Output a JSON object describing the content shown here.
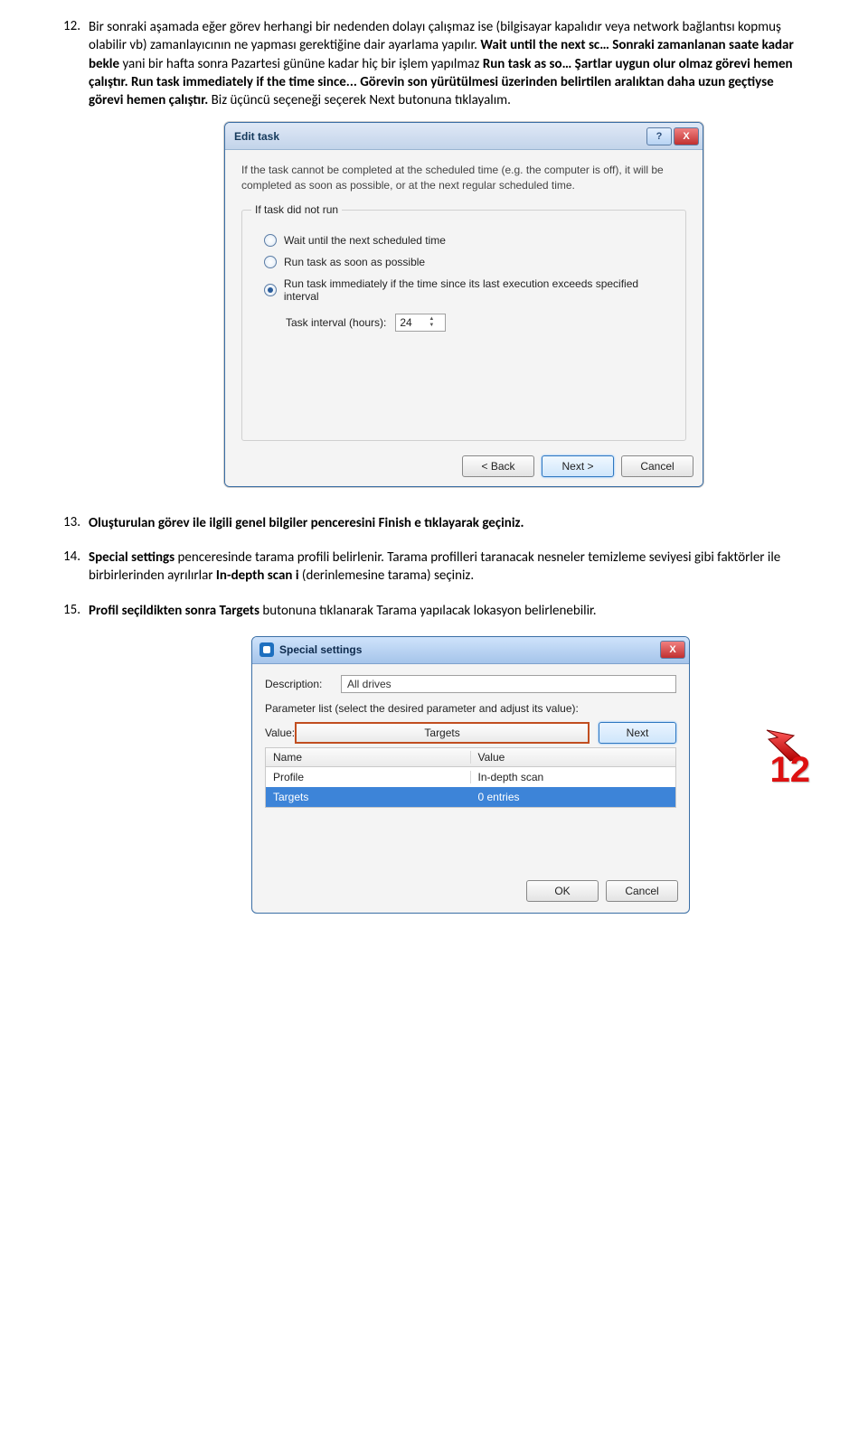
{
  "items": {
    "i12": {
      "num": "12.",
      "text_before_bold1": "Bir sonraki aşamada eğer görev herhangi bir nedenden dolayı çalışmaz ise (bilgisayar kapalıdır veya network bağlantısı kopmuş olabilir vb) zamanlayıcının ne yapması gerektiğine dair ayarlama yapılır. ",
      "bold1": "Wait until the next sc… Sonraki zamanlanan saate kadar bekle",
      "text_mid1": " yani bir hafta sonra Pazartesi gününe kadar hiç bir işlem yapılmaz ",
      "bold2": "Run task as so… Şartlar uygun olur olmaz görevi hemen çalıştır. Run task immediately if the time since... Görevin son yürütülmesi üzerinden belirtilen aralıktan daha uzun geçtiyse görevi hemen çalıştır.",
      "text_after": " Biz üçüncü seçeneği seçerek Next butonuna tıklayalım."
    },
    "i13": {
      "num": "13.",
      "bold": "Oluşturulan görev ile ilgili genel bilgiler penceresini Finish e tıklayarak geçiniz."
    },
    "i14": {
      "num": "14.",
      "bold1": "Special settings",
      "mid": " penceresinde tarama profili belirlenir. Tarama profilleri taranacak nesneler temizleme seviyesi gibi faktörler ile birbirlerinden ayrılırlar ",
      "bold2": "In-depth scan i",
      "after": " (derinlemesine tarama) seçiniz."
    },
    "i15": {
      "num": "15.",
      "bold": "Profil seçildikten sonra Targets",
      "after": " butonuna tıklanarak Tarama yapılacak lokasyon belirlenebilir."
    }
  },
  "dlg1": {
    "title": "Edit task",
    "help": "?",
    "close": "X",
    "info": "If the task cannot be completed at the scheduled time (e.g. the computer is off), it will be completed as soon as possible, or at the next regular scheduled time.",
    "legend": "If task did not run",
    "opt1": "Wait until the next scheduled time",
    "opt2": "Run task as soon as possible",
    "opt3": "Run task immediately if the time since its last execution exceeds specified interval",
    "interval_label": "Task interval (hours):",
    "interval_value": "24",
    "back": "< Back",
    "next": "Next >",
    "cancel": "Cancel"
  },
  "dlg2": {
    "title": "Special settings",
    "close": "X",
    "desc_label": "Description:",
    "desc_value": "All drives",
    "param_label": "Parameter list (select the desired parameter and adjust its value):",
    "value_label": "Value:",
    "targets_btn": "Targets",
    "next_btn": "Next",
    "col_name": "Name",
    "col_value": "Value",
    "row1_name": "Profile",
    "row1_value": "In-depth scan",
    "row2_name": "Targets",
    "row2_value": "0 entries",
    "callout": "12",
    "ok": "OK",
    "cancel": "Cancel"
  }
}
